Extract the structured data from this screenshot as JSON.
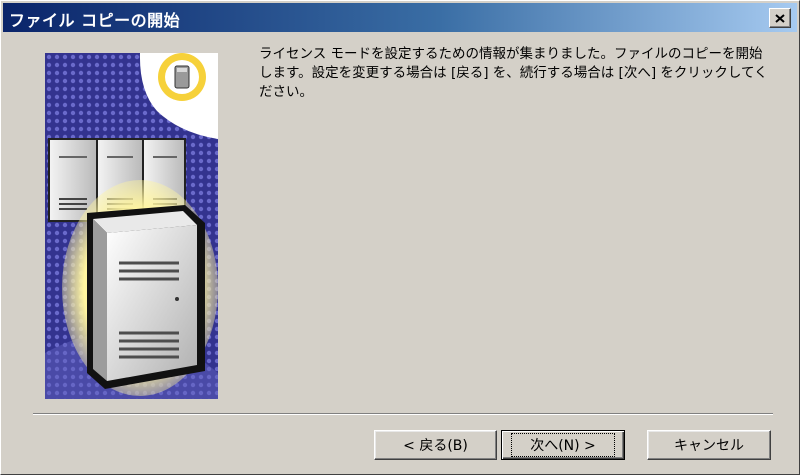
{
  "window": {
    "title": "ファイル コピーの開始"
  },
  "message": {
    "text": "ライセンス モードを設定するための情報が集まりました。ファイルのコピーを開始します。設定を変更する場合は [戻る] を、続行する場合は [次へ] をクリックしてください。"
  },
  "buttons": {
    "back": "< 戻る(B)",
    "next": "次へ(N) >",
    "cancel": "キャンセル"
  },
  "colors": {
    "title_start": "#0a246a",
    "title_end": "#a6caf0",
    "face": "#d4d0c8",
    "art_blue": "#3b3b9c",
    "art_yellow": "#f6d13a"
  }
}
